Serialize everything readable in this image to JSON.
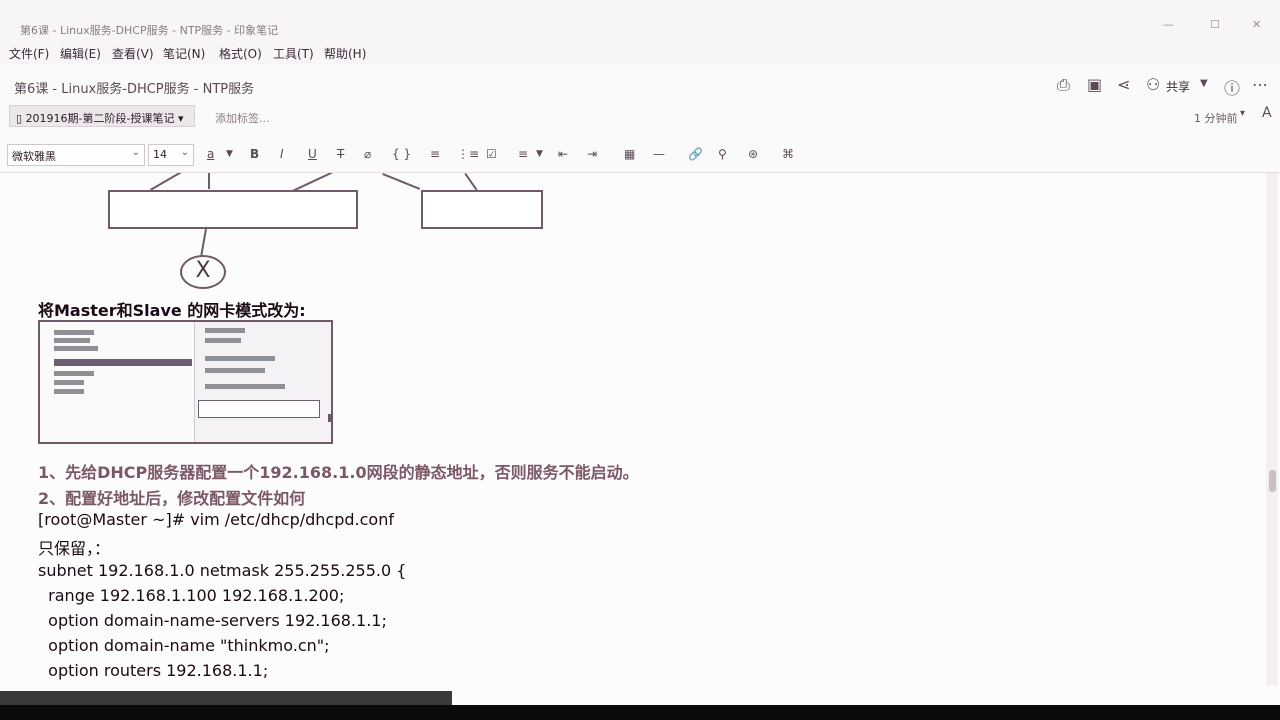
{
  "window": {
    "title": "第6课 - Linux服务-DHCP服务 - NTP服务 - 印象笔记",
    "controls": [
      "—",
      "☐",
      "✕"
    ]
  },
  "menu": [
    "文件(F)",
    "编辑(E)",
    "查看(V)",
    "笔记(N)",
    "格式(O)",
    "工具(T)",
    "帮助(H)"
  ],
  "note_header": {
    "title": "第6课 - Linux服务-DHCP服务 - NTP服务",
    "share_label": "共享",
    "notebook": "201916期-第二阶段-授课笔记",
    "add_tag": "添加标签...",
    "updated": "1 分钟前"
  },
  "format_bar": {
    "font": "微软雅黑",
    "size": "14",
    "buttons": [
      "a",
      "B",
      "I",
      "U",
      "T",
      "⌀",
      "{ }",
      "≡",
      "⋮≡",
      "☑",
      "≡",
      "⇤",
      "⇥",
      "▦",
      "—",
      "🔗",
      "⚲",
      "⊛",
      "⌘"
    ]
  },
  "diagram": {
    "node_label": "X"
  },
  "content": {
    "heading": "将Master和Slave 的网卡模式改为:",
    "step1": "1、先给DHCP服务器配置一个192.168.1.0网段的静态地址，否则服务不能启动。",
    "step2": "2、配置好地址后，修改配置文件如何",
    "cmd": "[root@Master ~]# vim /etc/dhcp/dhcpd.conf",
    "keep": "只保留，：",
    "code_lines": [
      "subnet 192.168.1.0 netmask 255.255.255.0 {",
      "  range 192.168.1.100 192.168.1.200;",
      "  option domain-name-servers 192.168.1.1;",
      "  option domain-name \"thinkmo.cn\";",
      "  option routers 192.168.1.1;"
    ]
  }
}
